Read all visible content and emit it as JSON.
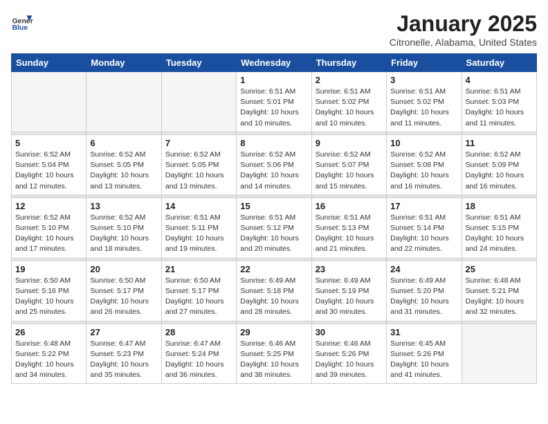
{
  "header": {
    "logo_general": "General",
    "logo_blue": "Blue",
    "month_title": "January 2025",
    "location": "Citronelle, Alabama, United States"
  },
  "weekdays": [
    "Sunday",
    "Monday",
    "Tuesday",
    "Wednesday",
    "Thursday",
    "Friday",
    "Saturday"
  ],
  "weeks": [
    [
      {
        "day": "",
        "info": ""
      },
      {
        "day": "",
        "info": ""
      },
      {
        "day": "",
        "info": ""
      },
      {
        "day": "1",
        "info": "Sunrise: 6:51 AM\nSunset: 5:01 PM\nDaylight: 10 hours\nand 10 minutes."
      },
      {
        "day": "2",
        "info": "Sunrise: 6:51 AM\nSunset: 5:02 PM\nDaylight: 10 hours\nand 10 minutes."
      },
      {
        "day": "3",
        "info": "Sunrise: 6:51 AM\nSunset: 5:02 PM\nDaylight: 10 hours\nand 11 minutes."
      },
      {
        "day": "4",
        "info": "Sunrise: 6:51 AM\nSunset: 5:03 PM\nDaylight: 10 hours\nand 11 minutes."
      }
    ],
    [
      {
        "day": "5",
        "info": "Sunrise: 6:52 AM\nSunset: 5:04 PM\nDaylight: 10 hours\nand 12 minutes."
      },
      {
        "day": "6",
        "info": "Sunrise: 6:52 AM\nSunset: 5:05 PM\nDaylight: 10 hours\nand 13 minutes."
      },
      {
        "day": "7",
        "info": "Sunrise: 6:52 AM\nSunset: 5:05 PM\nDaylight: 10 hours\nand 13 minutes."
      },
      {
        "day": "8",
        "info": "Sunrise: 6:52 AM\nSunset: 5:06 PM\nDaylight: 10 hours\nand 14 minutes."
      },
      {
        "day": "9",
        "info": "Sunrise: 6:52 AM\nSunset: 5:07 PM\nDaylight: 10 hours\nand 15 minutes."
      },
      {
        "day": "10",
        "info": "Sunrise: 6:52 AM\nSunset: 5:08 PM\nDaylight: 10 hours\nand 16 minutes."
      },
      {
        "day": "11",
        "info": "Sunrise: 6:52 AM\nSunset: 5:09 PM\nDaylight: 10 hours\nand 16 minutes."
      }
    ],
    [
      {
        "day": "12",
        "info": "Sunrise: 6:52 AM\nSunset: 5:10 PM\nDaylight: 10 hours\nand 17 minutes."
      },
      {
        "day": "13",
        "info": "Sunrise: 6:52 AM\nSunset: 5:10 PM\nDaylight: 10 hours\nand 18 minutes."
      },
      {
        "day": "14",
        "info": "Sunrise: 6:51 AM\nSunset: 5:11 PM\nDaylight: 10 hours\nand 19 minutes."
      },
      {
        "day": "15",
        "info": "Sunrise: 6:51 AM\nSunset: 5:12 PM\nDaylight: 10 hours\nand 20 minutes."
      },
      {
        "day": "16",
        "info": "Sunrise: 6:51 AM\nSunset: 5:13 PM\nDaylight: 10 hours\nand 21 minutes."
      },
      {
        "day": "17",
        "info": "Sunrise: 6:51 AM\nSunset: 5:14 PM\nDaylight: 10 hours\nand 22 minutes."
      },
      {
        "day": "18",
        "info": "Sunrise: 6:51 AM\nSunset: 5:15 PM\nDaylight: 10 hours\nand 24 minutes."
      }
    ],
    [
      {
        "day": "19",
        "info": "Sunrise: 6:50 AM\nSunset: 5:16 PM\nDaylight: 10 hours\nand 25 minutes."
      },
      {
        "day": "20",
        "info": "Sunrise: 6:50 AM\nSunset: 5:17 PM\nDaylight: 10 hours\nand 26 minutes."
      },
      {
        "day": "21",
        "info": "Sunrise: 6:50 AM\nSunset: 5:17 PM\nDaylight: 10 hours\nand 27 minutes."
      },
      {
        "day": "22",
        "info": "Sunrise: 6:49 AM\nSunset: 5:18 PM\nDaylight: 10 hours\nand 28 minutes."
      },
      {
        "day": "23",
        "info": "Sunrise: 6:49 AM\nSunset: 5:19 PM\nDaylight: 10 hours\nand 30 minutes."
      },
      {
        "day": "24",
        "info": "Sunrise: 6:49 AM\nSunset: 5:20 PM\nDaylight: 10 hours\nand 31 minutes."
      },
      {
        "day": "25",
        "info": "Sunrise: 6:48 AM\nSunset: 5:21 PM\nDaylight: 10 hours\nand 32 minutes."
      }
    ],
    [
      {
        "day": "26",
        "info": "Sunrise: 6:48 AM\nSunset: 5:22 PM\nDaylight: 10 hours\nand 34 minutes."
      },
      {
        "day": "27",
        "info": "Sunrise: 6:47 AM\nSunset: 5:23 PM\nDaylight: 10 hours\nand 35 minutes."
      },
      {
        "day": "28",
        "info": "Sunrise: 6:47 AM\nSunset: 5:24 PM\nDaylight: 10 hours\nand 36 minutes."
      },
      {
        "day": "29",
        "info": "Sunrise: 6:46 AM\nSunset: 5:25 PM\nDaylight: 10 hours\nand 38 minutes."
      },
      {
        "day": "30",
        "info": "Sunrise: 6:46 AM\nSunset: 5:26 PM\nDaylight: 10 hours\nand 39 minutes."
      },
      {
        "day": "31",
        "info": "Sunrise: 6:45 AM\nSunset: 5:26 PM\nDaylight: 10 hours\nand 41 minutes."
      },
      {
        "day": "",
        "info": ""
      }
    ]
  ]
}
